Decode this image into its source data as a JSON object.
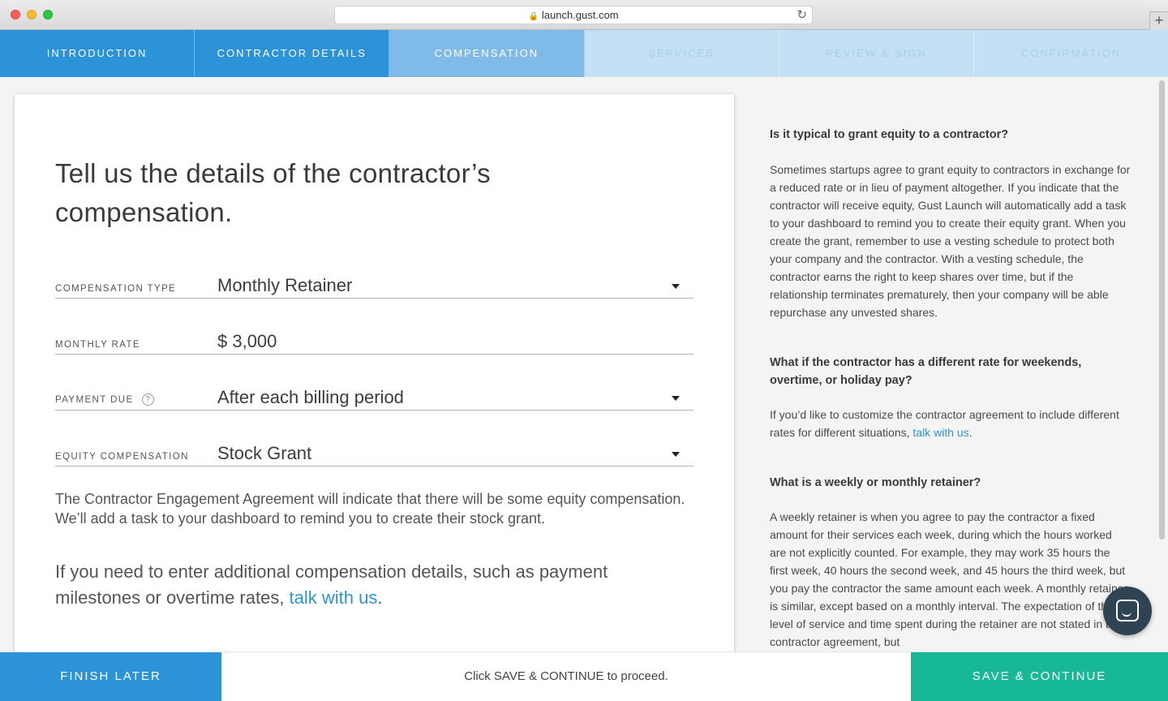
{
  "browser": {
    "url": "launch.gust.com"
  },
  "steps": [
    {
      "label": "INTRODUCTION",
      "state": "done"
    },
    {
      "label": "CONTRACTOR DETAILS",
      "state": "done"
    },
    {
      "label": "COMPENSATION",
      "state": "active"
    },
    {
      "label": "SERVICES",
      "state": "future"
    },
    {
      "label": "REVIEW & SIGN",
      "state": "future"
    },
    {
      "label": "CONFIRMATION",
      "state": "future"
    }
  ],
  "form": {
    "heading": "Tell us the details of the contractor’s compensation.",
    "fields": [
      {
        "label": "COMPENSATION TYPE",
        "value": "Monthly Retainer",
        "type": "select"
      },
      {
        "label": "MONTHLY RATE",
        "value": "$ 3,000",
        "type": "input"
      },
      {
        "label": "PAYMENT DUE",
        "value": "After each billing period",
        "type": "select"
      },
      {
        "label": "EQUITY COMPENSATION",
        "value": "Stock Grant",
        "type": "select"
      }
    ],
    "help_icon": "?",
    "equity_note": "The Contractor Engagement Agreement will indicate that there will be some equity compensation. We’ll add a task to your dashboard to remind you to create their stock grant.",
    "extra_prefix": "If you need to enter additional compensation details, such as payment milestones or overtime rates, ",
    "extra_link": "talk with us",
    "extra_suffix": "."
  },
  "faq": [
    {
      "question": "Is it typical to grant equity to a contractor?",
      "answer": "Sometimes startups agree to grant equity to contractors in exchange for a reduced rate or in lieu of payment altogether. If you indicate that the contractor will receive equity, Gust Launch will automatically add a task to your dashboard to remind you to create their equity grant. When you create the grant, remember to use a vesting schedule to protect both your company and the contractor. With a vesting schedule, the contractor earns the right to keep shares over time, but if the relationship terminates prematurely, then your company will be able repurchase any unvested shares."
    },
    {
      "question": "What if the contractor has a different rate for weekends, overtime, or holiday pay?",
      "answer_prefix": "If you’d like to customize the contractor agreement to include different rates for different situations, ",
      "answer_link": "talk with us",
      "answer_suffix": "."
    },
    {
      "question": "What is a weekly or monthly retainer?",
      "answer": "A weekly retainer is when you agree to pay the contractor a fixed amount for their services each week, during which the hours worked are not explicitly counted. For example, they may work 35 hours the first week, 40 hours the second week, and 45 hours the third week, but you pay the contractor the same amount each week. A monthly retainer is similar, except based on a monthly interval. The expectation of the level of service and time spent during the retainer are not stated in the contractor agreement, but"
    }
  ],
  "footer": {
    "finish_label": "FINISH LATER",
    "hint": "Click SAVE & CONTINUE to proceed.",
    "save_label": "SAVE & CONTINUE"
  },
  "colors": {
    "step_done": "#2c93d8",
    "step_active": "#7fbae8",
    "step_future": "#c3e0f5",
    "finish": "#2c93d8",
    "save": "#17b897",
    "link": "#2c93d8"
  }
}
